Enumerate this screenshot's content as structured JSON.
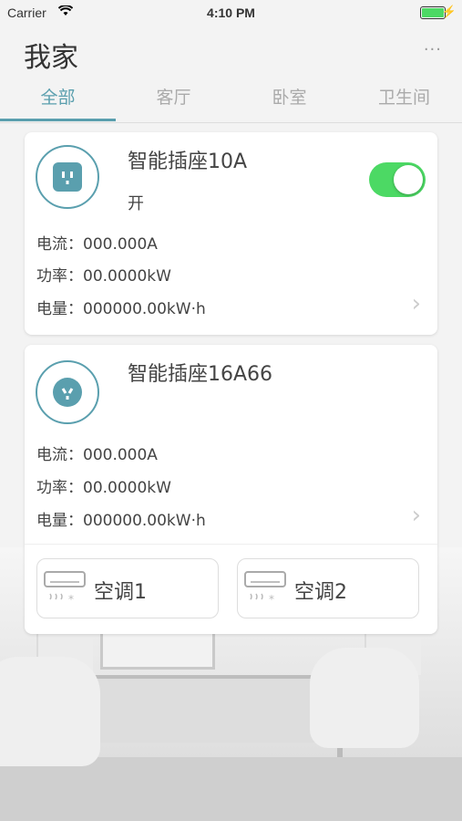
{
  "status_bar": {
    "carrier": "Carrier",
    "time": "4:10 PM"
  },
  "header": {
    "title": "我家",
    "more_label": "···"
  },
  "tabs": [
    {
      "label": "全部",
      "active": true
    },
    {
      "label": "客厅",
      "active": false
    },
    {
      "label": "卧室",
      "active": false
    },
    {
      "label": "卫生间",
      "active": false
    }
  ],
  "devices": [
    {
      "name": "智能插座10A",
      "status": "开",
      "switch_on": true,
      "current": "电流：000.000A",
      "power": "功率：00.0000kW",
      "energy": "电量：000000.00kW·h"
    },
    {
      "name": "智能插座16A66",
      "current": "电流：000.000A",
      "power": "功率：00.0000kW",
      "energy": "电量：000000.00kW·h",
      "ac_units": [
        {
          "label": "空调1"
        },
        {
          "label": "空调2"
        }
      ]
    }
  ],
  "colors": {
    "accent": "#5a9fae",
    "switch_on": "#4cd964"
  }
}
